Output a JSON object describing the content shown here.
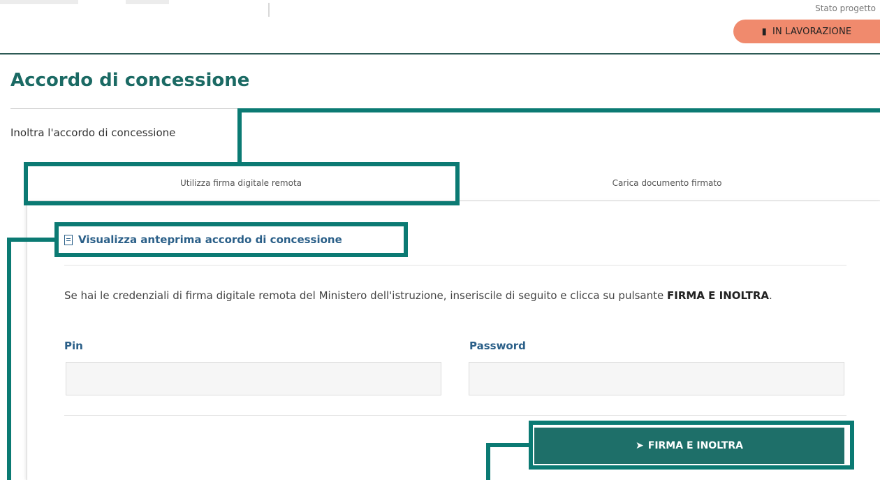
{
  "header": {
    "state_label": "Stato progetto",
    "state_badge": "IN LAVORAZIONE",
    "state_badge_icon": "document-icon",
    "state_badge_color": "#f08a6d"
  },
  "page": {
    "title": "Accordo di concessione",
    "section_title": "Inoltra l'accordo di concessione"
  },
  "tabs": [
    {
      "label": "Utilizza firma digitale remota",
      "active": true
    },
    {
      "label": "Carica documento firmato",
      "active": false
    }
  ],
  "panel": {
    "preview_link": "Visualizza anteprima accordo di concessione",
    "instructions_text": "Se hai le credenziali di firma digitale remota del Ministero dell'istruzione, inseriscile di seguito e clicca su pulsante",
    "instructions_button_name": "FIRMA E INOLTRA",
    "instructions_end": ".",
    "pin_label": "Pin",
    "pin_value": "",
    "password_label": "Password",
    "password_value": "",
    "submit_label": "FIRMA E INOLTRA",
    "submit_icon": "paper-plane-icon"
  },
  "colors": {
    "accent": "#1b6a64",
    "button": "#1e6f69",
    "link": "#2a5f88",
    "annotation": "#0b7a73"
  }
}
